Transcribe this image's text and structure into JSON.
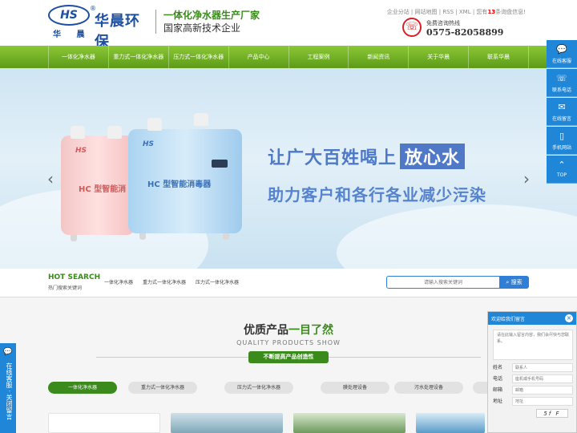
{
  "header": {
    "logo_mark": "HS",
    "logo_sub": "华 晨",
    "logo_name": "华晨环保",
    "logo_reg": "®",
    "slogan_main": "一体化净水器生产厂家",
    "slogan_sub": "国家高新技术企业",
    "toplinks_prefix": "企业分站 | 网站地图 | RSS | XML | 您有",
    "toplinks_count": "13",
    "toplinks_suffix": "条询盘信息!",
    "hotline_label": "免费咨询热线",
    "hotline_number": "0575-82058899"
  },
  "nav": {
    "items": [
      {
        "label": "一体化净水器"
      },
      {
        "label": "重力式一体化净水器"
      },
      {
        "label": "压力式一体化净水器"
      },
      {
        "label": "产品中心"
      },
      {
        "label": "工程案例"
      },
      {
        "label": "新闻资讯"
      },
      {
        "label": "关于华晨"
      },
      {
        "label": "联系华晨"
      }
    ]
  },
  "banner": {
    "line1_prefix": "让广大百姓喝上",
    "line1_highlight": "放心水",
    "line2": "助力客户和各行各业减少污染",
    "machine_red_label": "HC 型智能消",
    "machine_blue_label": "HC 型智能消毒器",
    "machine_logo": "HS",
    "prev_arrow": "‹",
    "next_arrow": "›"
  },
  "hot_search": {
    "title": "HOT SEARCH",
    "subtitle": "热门搜索关键词",
    "keywords": [
      {
        "label": "一体化净水器"
      },
      {
        "label": "重力式一体化净水器"
      },
      {
        "label": "压力式一体化净水器"
      }
    ],
    "placeholder": "请输入搜索关键词",
    "button_label": "搜索",
    "search_icon": "search-icon"
  },
  "products": {
    "title_prefix": "优质产品",
    "title_highlight": "一目了然",
    "title_en": "QUALITY PRODUCTS SHOW",
    "tagline": "不断提高产品创造性",
    "tabs": [
      {
        "label": "一体化净水器",
        "active": true
      },
      {
        "label": "重力式一体化净水器",
        "active": false
      },
      {
        "label": "压力式一体化净水器",
        "active": false
      },
      {
        "label": "膜处理设备",
        "active": false
      },
      {
        "label": "污水处理设备",
        "active": false
      },
      {
        "label": "污",
        "active": false
      }
    ]
  },
  "side_toolbar": {
    "items": [
      {
        "label": "在线客服",
        "icon": "chat-icon"
      },
      {
        "label": "联系电话",
        "icon": "phone-icon"
      },
      {
        "label": "在线留言",
        "icon": "message-icon"
      },
      {
        "label": "手机网站",
        "icon": "mobile-icon"
      },
      {
        "label": "TOP",
        "icon": "arrow-up-icon"
      }
    ]
  },
  "left_float": {
    "text": "在线客服 · 关闭留言"
  },
  "message_widget": {
    "title": "欢迎给我们留言",
    "close": "×",
    "textarea_placeholder": "请在此输入留言内容，我们会尽快与您联系。",
    "fields": [
      {
        "label": "姓名",
        "placeholder": "联系人"
      },
      {
        "label": "电话",
        "placeholder": "座机或手机号码"
      },
      {
        "label": "邮箱",
        "placeholder": "邮箱"
      },
      {
        "label": "地址",
        "placeholder": "地址"
      }
    ],
    "captcha": "5f F"
  },
  "colors": {
    "brand_green": "#3a8a1c",
    "nav_green": "#6aa81f",
    "brand_blue": "#1c4fa0",
    "accent_blue": "#1f86d8",
    "hotline_red": "#d71f26"
  }
}
